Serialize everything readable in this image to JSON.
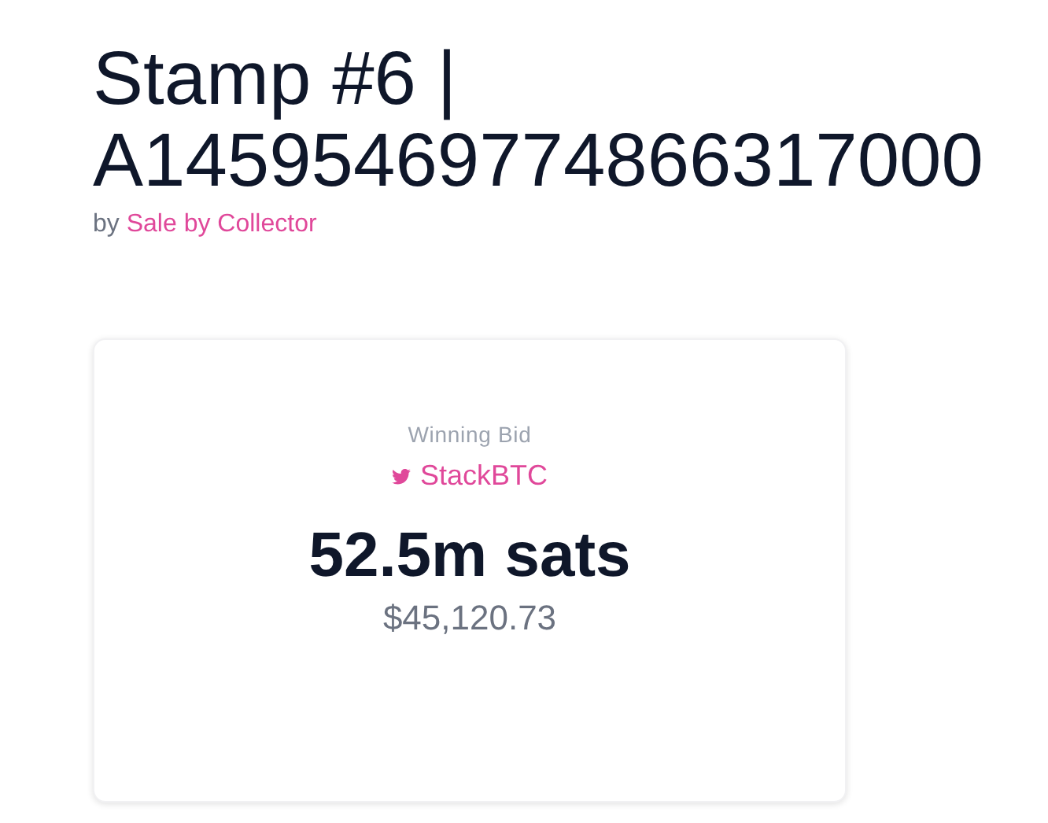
{
  "title": "Stamp #6 | A14595469774866317000",
  "byline": {
    "prefix": "by",
    "seller": "Sale by Collector"
  },
  "bid_card": {
    "label": "Winning Bid",
    "bidder": "StackBTC",
    "amount": "52.5m sats",
    "fiat": "$45,120.73"
  }
}
